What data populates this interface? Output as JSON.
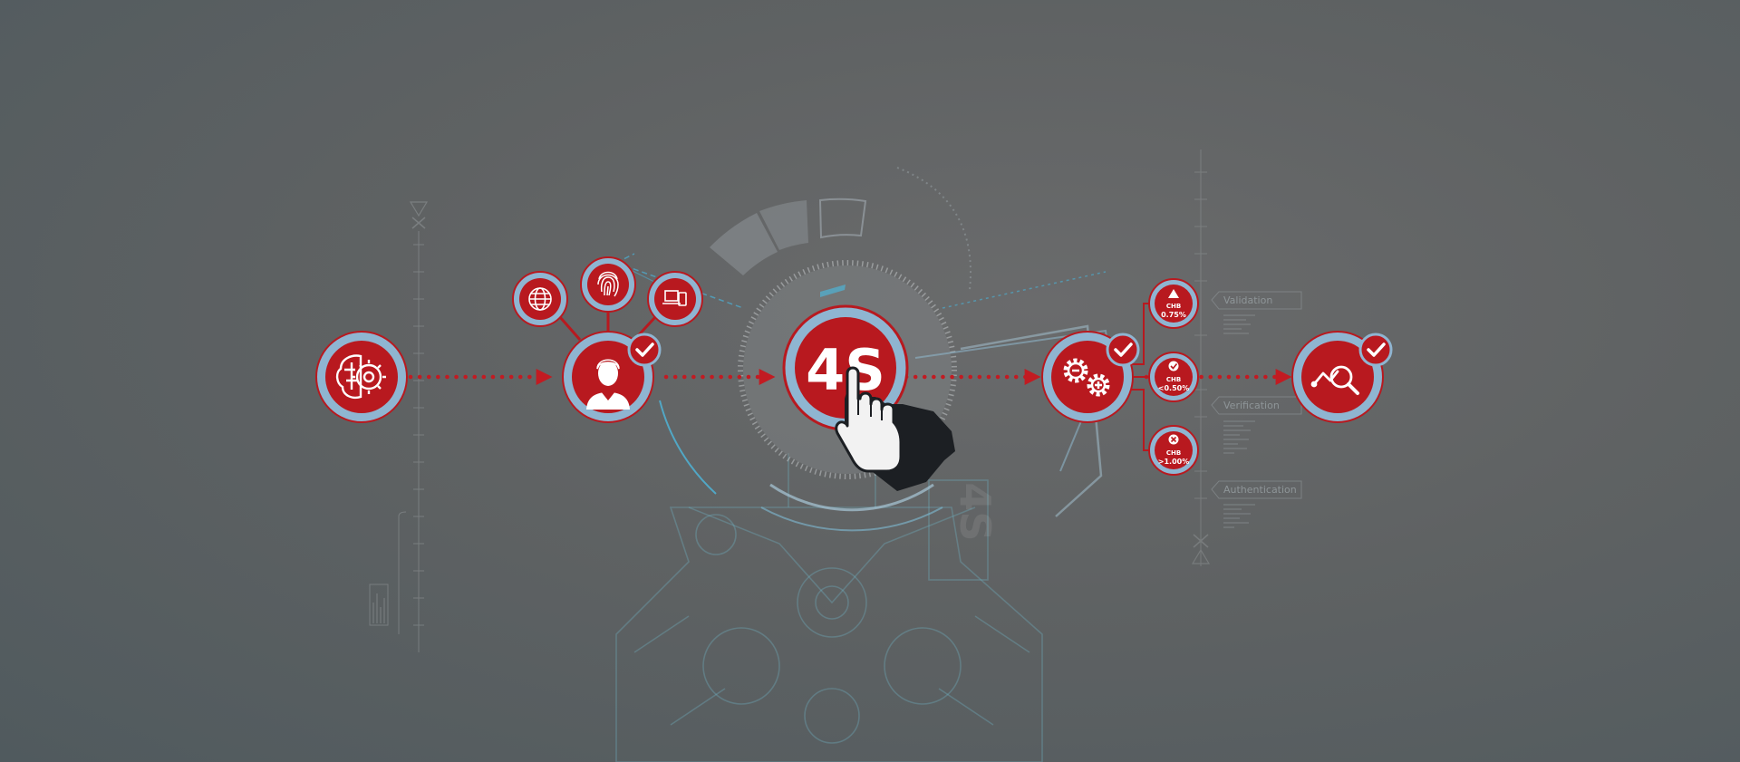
{
  "center_logo": {
    "text": "4S",
    "ghost_text": "4S"
  },
  "checks": [
    {
      "level": "CHB",
      "value": "0.75%",
      "status": "warning-icon"
    },
    {
      "level": "CHB",
      "value": "<0.50%",
      "status": "check-icon"
    },
    {
      "level": "CHB",
      "value": ">1.00%",
      "status": "x-icon"
    }
  ],
  "tags": {
    "validation": "Validation",
    "verification": "Verification",
    "authentication": "Authentication"
  },
  "colors": {
    "accent_red": "#b8191f",
    "ring_blue": "#8fb5d1",
    "line_blue": "#4fa8c8",
    "background": "#5f6263"
  }
}
